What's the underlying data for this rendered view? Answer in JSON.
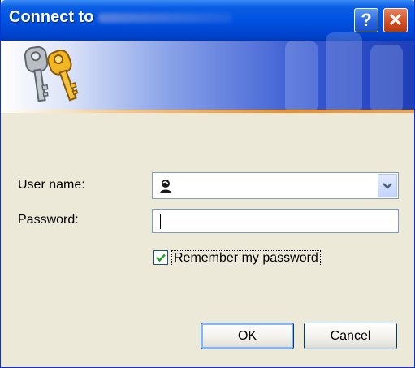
{
  "window": {
    "title": "Connect to",
    "help_label": "?",
    "close_label": "✕"
  },
  "form": {
    "username_label": "User name:",
    "username_value": "",
    "password_label": "Password:",
    "password_value": "",
    "remember_label": "Remember my password",
    "remember_checked": true
  },
  "buttons": {
    "ok_label": "OK",
    "cancel_label": "Cancel"
  },
  "icons": {
    "banner": "keys-icon",
    "username": "user-icon",
    "dropdown": "chevron-down-icon",
    "checkbox": "checkmark-icon"
  },
  "colors": {
    "title_bar": "#0054e3",
    "dialog_bg": "#ece9d8",
    "accent_line": "#f08f26",
    "close_button": "#d24c20"
  }
}
